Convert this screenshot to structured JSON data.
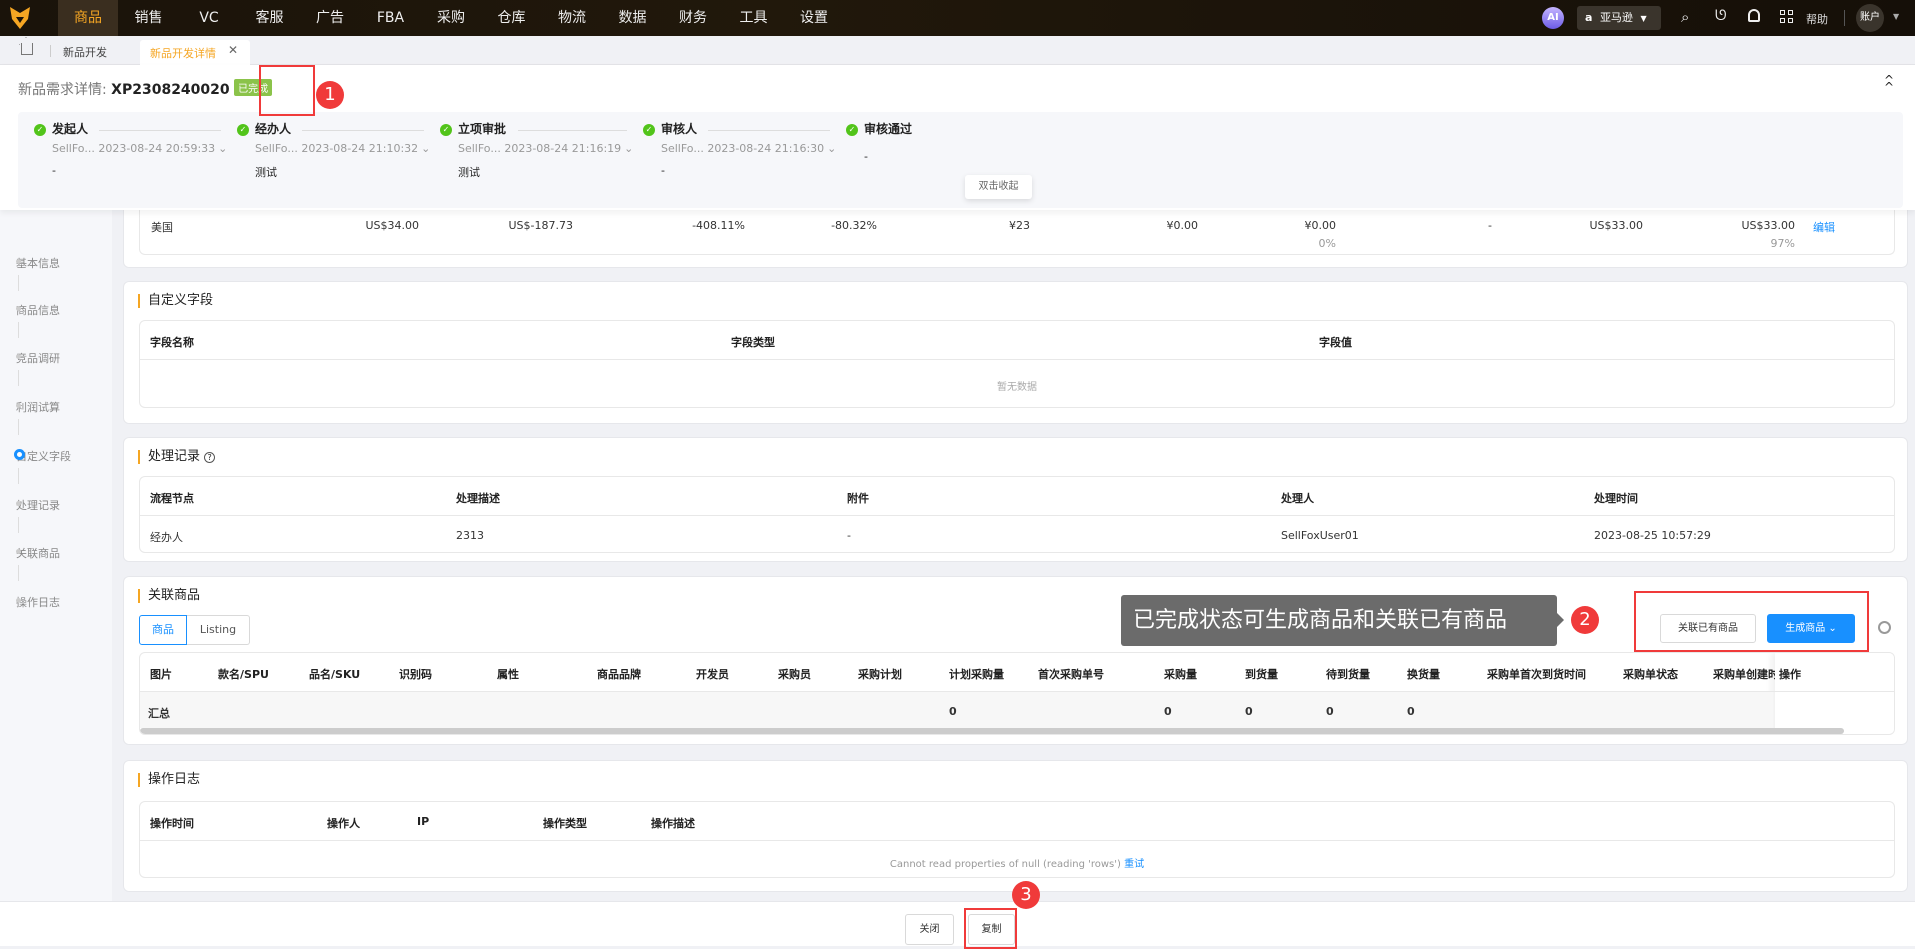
{
  "topnav": {
    "items": [
      "商品",
      "销售",
      "VC",
      "客服",
      "广告",
      "FBA",
      "采购",
      "仓库",
      "物流",
      "数据",
      "财务",
      "工具",
      "设置"
    ],
    "active": "商品",
    "ai_label": "AI",
    "marketplace": "亚马逊",
    "help": "帮助",
    "account": "账户",
    "accent": "#f5a623"
  },
  "tabs": {
    "items": [
      "新品开发",
      "新品开发详情"
    ]
  },
  "header": {
    "title_prefix": "新品需求详情:",
    "id": "XP2308240020",
    "status": "已完成",
    "status_color": "#8bc34a"
  },
  "stepper": {
    "steps": [
      {
        "name": "发起人",
        "who": "SellFo... 2023-08-24 20:59:33",
        "note": "-"
      },
      {
        "name": "经办人",
        "who": "SellFo... 2023-08-24 21:10:32",
        "note": "测试"
      },
      {
        "name": "立项审批",
        "who": "SellFo... 2023-08-24 21:16:19",
        "note": "测试"
      },
      {
        "name": "审核人",
        "who": "SellFo... 2023-08-24 21:16:30",
        "note": "-"
      },
      {
        "name": "审核通过",
        "who": "",
        "note": "-"
      }
    ],
    "tooltip": "双击收起"
  },
  "leftnav": {
    "items": [
      "基本信息",
      "商品信息",
      "竞品调研",
      "利润试算",
      "自定义字段",
      "处理记录",
      "关联商品",
      "操作日志"
    ],
    "active": "自定义字段"
  },
  "profit_row": {
    "country": "美国",
    "price": "US$34.00",
    "profit": "US$-187.73",
    "margin": "-408.11%",
    "roi": "-80.32%",
    "cost": "¥23",
    "freight": "¥0.00",
    "fee": "¥0.00",
    "fee_pct": "0%",
    "dash": "-",
    "c1": "US$33.00",
    "c2": "US$33.00",
    "c2_pct": "97%",
    "edit": "编辑"
  },
  "custom_fields": {
    "title": "自定义字段",
    "headers": [
      "字段名称",
      "字段类型",
      "字段值"
    ],
    "empty": "暂无数据"
  },
  "process_log": {
    "title": "处理记录",
    "headers": [
      "流程节点",
      "处理描述",
      "附件",
      "处理人",
      "处理时间"
    ],
    "rows": [
      [
        "经办人",
        "2313",
        "-",
        "SellFoxUser01",
        "2023-08-25 10:57:29"
      ]
    ]
  },
  "related": {
    "title": "关联商品",
    "tabs": [
      "商品",
      "Listing"
    ],
    "link_button": "关联已有商品",
    "create_button": "生成商品",
    "headers": [
      "图片",
      "款名/SPU",
      "品名/SKU",
      "识别码",
      "属性",
      "商品品牌",
      "开发员",
      "采购员",
      "采购计划",
      "计划采购量",
      "首次采购单号",
      "采购量",
      "到货量",
      "待到货量",
      "换货量",
      "采购单首次到货时间",
      "采购单状态",
      "采购单创建时",
      "操作"
    ],
    "summary_label": "汇总",
    "summary": {
      "9": "0",
      "11": "0",
      "12": "0",
      "13": "0",
      "14": "0"
    }
  },
  "oplog": {
    "title": "操作日志",
    "headers": [
      "操作时间",
      "操作人",
      "IP",
      "操作类型",
      "操作描述"
    ],
    "error": "Cannot read properties of null (reading 'rows')",
    "retry": "重试"
  },
  "footer": {
    "close": "关闭",
    "copy": "复制"
  },
  "annotations": {
    "1": "1",
    "2": "2",
    "3": "3",
    "callout": "已完成状态可生成商品和关联已有商品"
  }
}
